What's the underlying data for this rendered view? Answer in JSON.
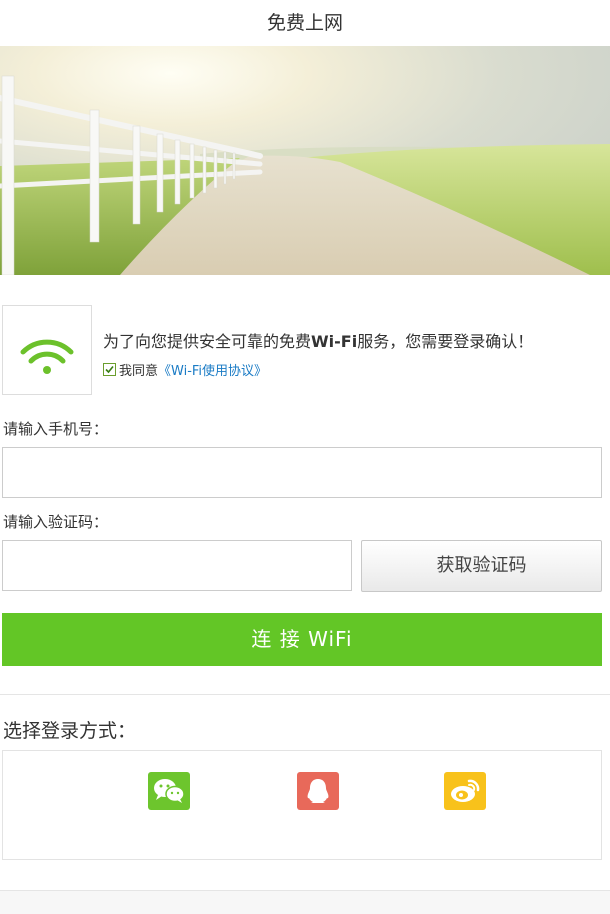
{
  "header": {
    "title": "免费上网"
  },
  "notice": {
    "text_before": "为了向您提供安全可靠的免费",
    "text_bold": "Wi-Fi",
    "text_after": "服务，您需要登录确认！"
  },
  "agreement": {
    "label": "我同意",
    "link_text": "《Wi-Fi使用协议》",
    "checked": true
  },
  "phone": {
    "label": "请输入手机号：",
    "value": "",
    "placeholder": ""
  },
  "code": {
    "label": "请输入验证码：",
    "value": "",
    "placeholder": "",
    "button_label": "获取验证码"
  },
  "connect": {
    "button_label": "连 接 WiFi"
  },
  "login": {
    "title": "选择登录方式：",
    "options": [
      {
        "icon": "wechat-icon",
        "color": "#6dc52d"
      },
      {
        "icon": "qq-icon",
        "color": "#e8695a"
      },
      {
        "icon": "weibo-icon",
        "color": "#f8c21b"
      }
    ]
  },
  "colors": {
    "accent": "#63c626",
    "link": "#1a7bc5"
  }
}
